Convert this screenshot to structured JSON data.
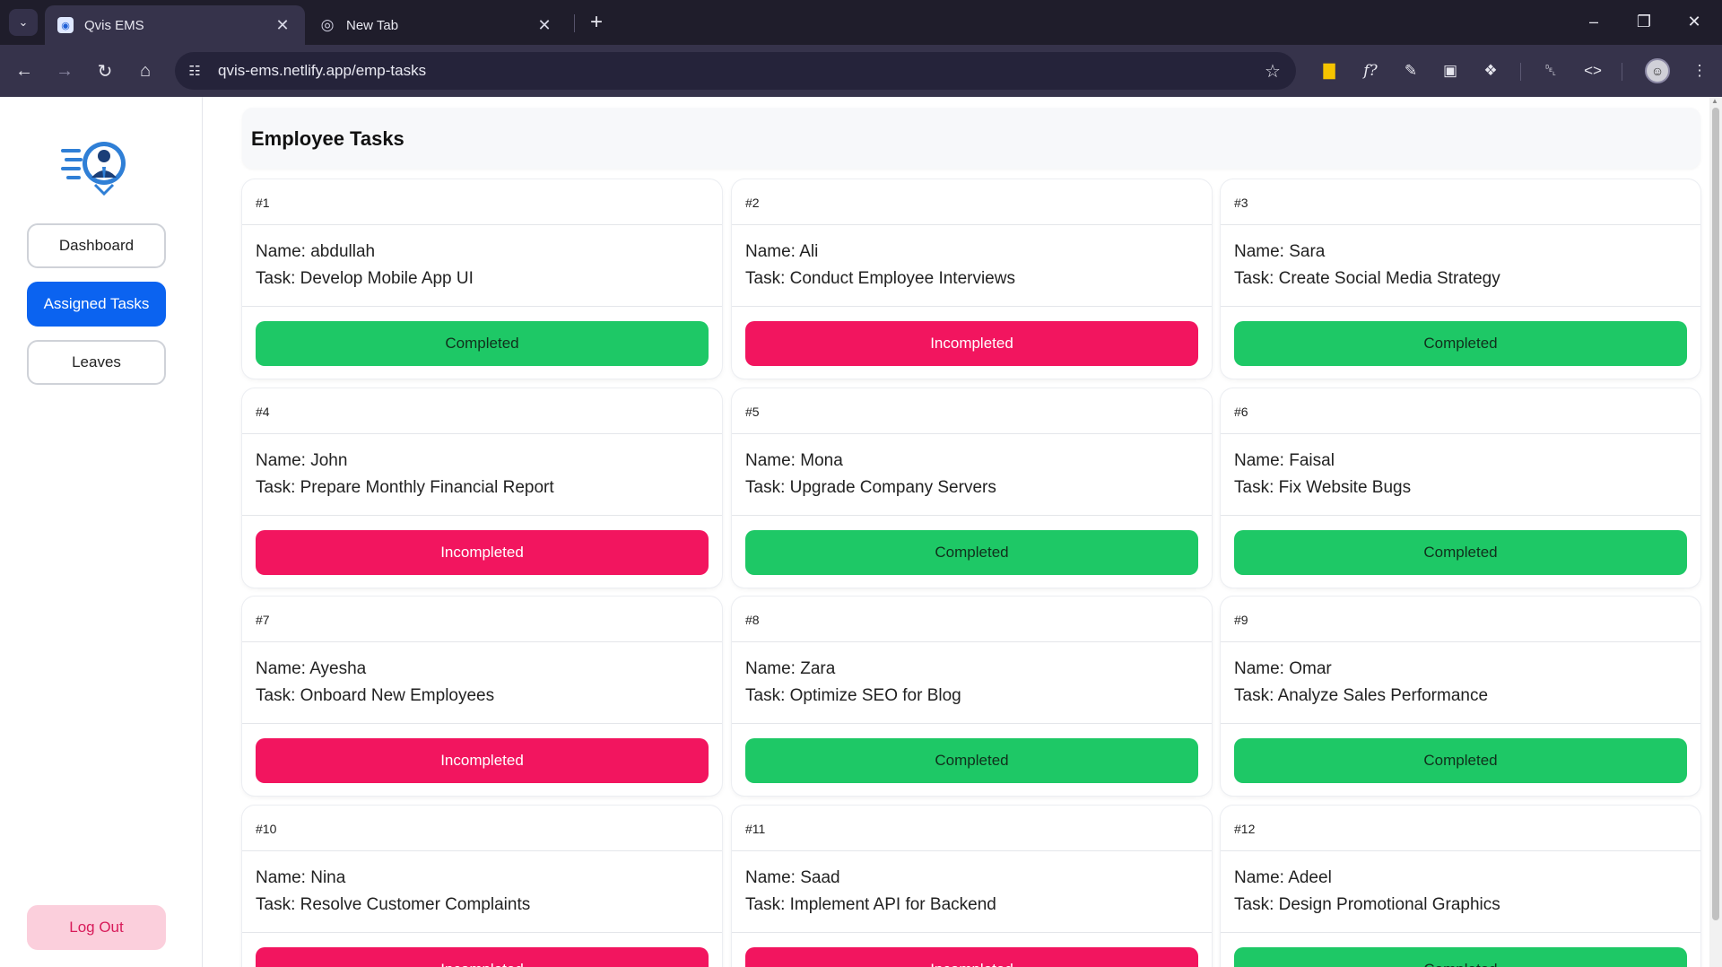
{
  "browser": {
    "tabs": [
      {
        "title": "Qvis EMS",
        "active": true
      },
      {
        "title": "New Tab",
        "active": false
      }
    ],
    "url": "qvis-ems.netlify.app/emp-tasks"
  },
  "sidebar": {
    "items": [
      {
        "label": "Dashboard",
        "active": false
      },
      {
        "label": "Assigned Tasks",
        "active": true
      },
      {
        "label": "Leaves",
        "active": false
      }
    ],
    "logout_label": "Log Out"
  },
  "main": {
    "title": "Employee Tasks",
    "tasks": [
      {
        "id": "#1",
        "name": "Name: abdullah",
        "task": "Task: Develop Mobile App UI",
        "status": "Completed"
      },
      {
        "id": "#2",
        "name": "Name: Ali",
        "task": "Task: Conduct Employee Interviews",
        "status": "Incompleted"
      },
      {
        "id": "#3",
        "name": "Name: Sara",
        "task": "Task: Create Social Media Strategy",
        "status": "Completed"
      },
      {
        "id": "#4",
        "name": "Name: John",
        "task": "Task: Prepare Monthly Financial Report",
        "status": "Incompleted"
      },
      {
        "id": "#5",
        "name": "Name: Mona",
        "task": "Task: Upgrade Company Servers",
        "status": "Completed"
      },
      {
        "id": "#6",
        "name": "Name: Faisal",
        "task": "Task: Fix Website Bugs",
        "status": "Completed"
      },
      {
        "id": "#7",
        "name": "Name: Ayesha",
        "task": "Task: Onboard New Employees",
        "status": "Incompleted"
      },
      {
        "id": "#8",
        "name": "Name: Zara",
        "task": "Task: Optimize SEO for Blog",
        "status": "Completed"
      },
      {
        "id": "#9",
        "name": "Name: Omar",
        "task": "Task: Analyze Sales Performance",
        "status": "Completed"
      },
      {
        "id": "#10",
        "name": "Name: Nina",
        "task": "Task: Resolve Customer Complaints",
        "status": "Incompleted"
      },
      {
        "id": "#11",
        "name": "Name: Saad",
        "task": "Task: Implement API for Backend",
        "status": "Incompleted"
      },
      {
        "id": "#12",
        "name": "Name: Adeel",
        "task": "Task: Design Promotional Graphics",
        "status": "Completed"
      }
    ]
  },
  "colors": {
    "completed": "#1ec866",
    "incompleted": "#f2155f",
    "active_nav": "#0b63f0",
    "logout_bg": "#fbcfdc"
  }
}
